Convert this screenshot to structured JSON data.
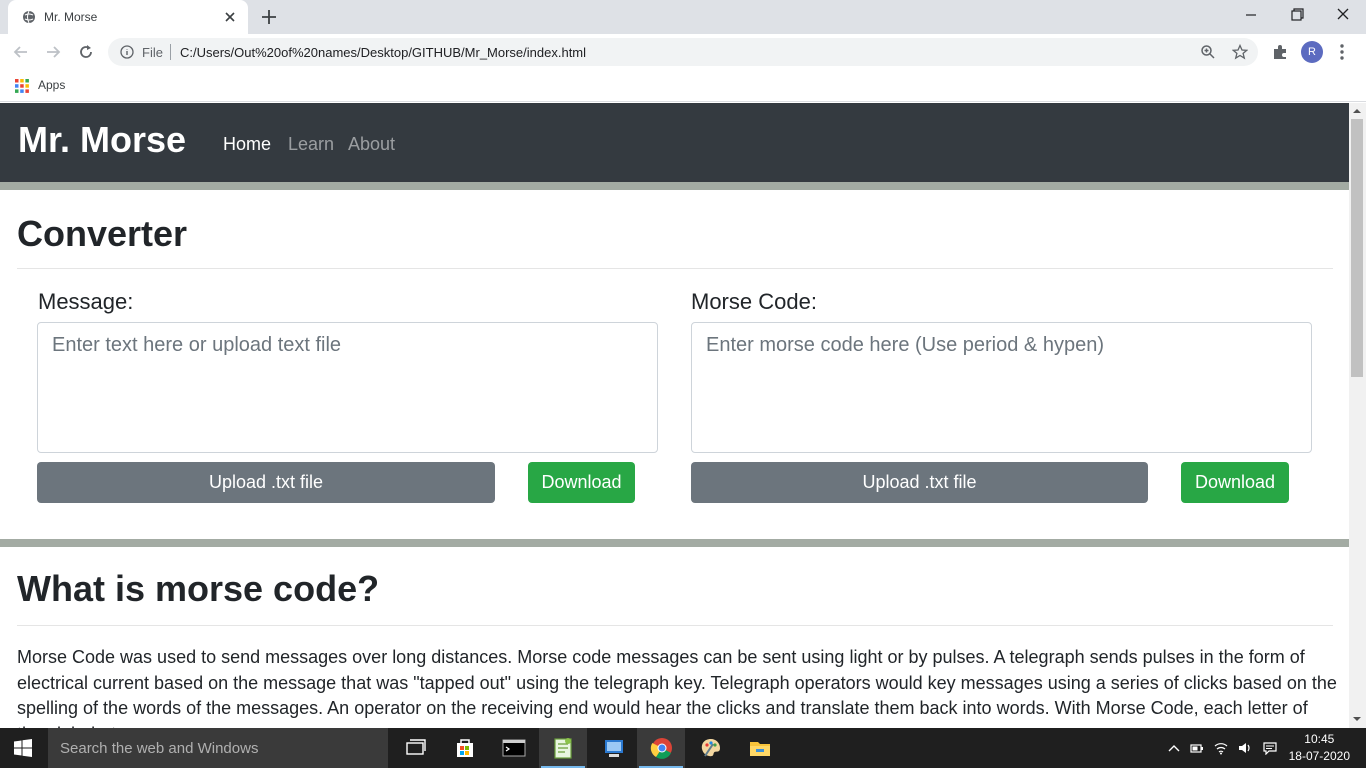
{
  "browser": {
    "tab_title": "Mr. Morse",
    "omnibox_scheme": "File",
    "url": "C:/Users/Out%20of%20names/Desktop/GITHUB/Mr_Morse/index.html",
    "profile_initial": "R",
    "bookmarks_apps_label": "Apps"
  },
  "site": {
    "brand": "Mr. Morse",
    "nav": [
      "Home",
      "Learn",
      "About"
    ],
    "active_nav": "Home"
  },
  "converter": {
    "heading": "Converter",
    "message_label": "Message:",
    "message_placeholder": "Enter text here or upload text file",
    "morse_label": "Morse Code:",
    "morse_placeholder": "Enter morse code here (Use period & hypen)",
    "upload_label": "Upload .txt file",
    "download_label": "Download"
  },
  "about": {
    "heading": "What is morse code?",
    "paragraph": "Morse Code was used to send messages over long distances. Morse code messages can be sent using light or by pulses. A telegraph sends pulses in the form of electrical current based on the message that was \"tapped out\" using the telegraph key. Telegraph operators would key messages using a series of clicks based on the spelling of the words of the messages. An operator on the receiving end would hear the clicks and translate them back into words. With Morse Code, each letter of the alphabet was"
  },
  "taskbar": {
    "search_placeholder": "Search the web and Windows",
    "time": "10:45",
    "date": "18-07-2020"
  },
  "colors": {
    "navbar_bg": "#343a40",
    "divider_band": "#a3aba3",
    "btn_secondary": "#6c757d",
    "btn_success": "#28a745"
  }
}
